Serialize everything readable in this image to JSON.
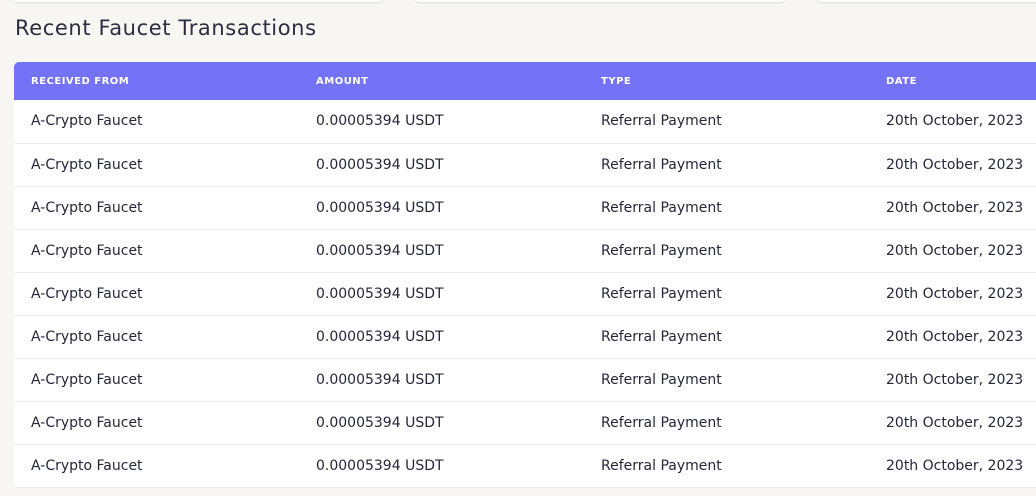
{
  "section": {
    "title": "Recent Faucet Transactions"
  },
  "table": {
    "headers": {
      "from": "RECEIVED FROM",
      "amount": "AMOUNT",
      "type": "TYPE",
      "date": "DATE"
    },
    "rows": [
      {
        "from": "A-Crypto Faucet",
        "amount": "0.00005394 USDT",
        "type": "Referral Payment",
        "date": "20th October, 2023"
      },
      {
        "from": "A-Crypto Faucet",
        "amount": "0.00005394 USDT",
        "type": "Referral Payment",
        "date": "20th October, 2023"
      },
      {
        "from": "A-Crypto Faucet",
        "amount": "0.00005394 USDT",
        "type": "Referral Payment",
        "date": "20th October, 2023"
      },
      {
        "from": "A-Crypto Faucet",
        "amount": "0.00005394 USDT",
        "type": "Referral Payment",
        "date": "20th October, 2023"
      },
      {
        "from": "A-Crypto Faucet",
        "amount": "0.00005394 USDT",
        "type": "Referral Payment",
        "date": "20th October, 2023"
      },
      {
        "from": "A-Crypto Faucet",
        "amount": "0.00005394 USDT",
        "type": "Referral Payment",
        "date": "20th October, 2023"
      },
      {
        "from": "A-Crypto Faucet",
        "amount": "0.00005394 USDT",
        "type": "Referral Payment",
        "date": "20th October, 2023"
      },
      {
        "from": "A-Crypto Faucet",
        "amount": "0.00005394 USDT",
        "type": "Referral Payment",
        "date": "20th October, 2023"
      },
      {
        "from": "A-Crypto Faucet",
        "amount": "0.00005394 USDT",
        "type": "Referral Payment",
        "date": "20th October, 2023"
      }
    ]
  },
  "colors": {
    "header_bg": "#7472f7",
    "page_bg": "#f7f6f3",
    "text": "#26263a"
  }
}
